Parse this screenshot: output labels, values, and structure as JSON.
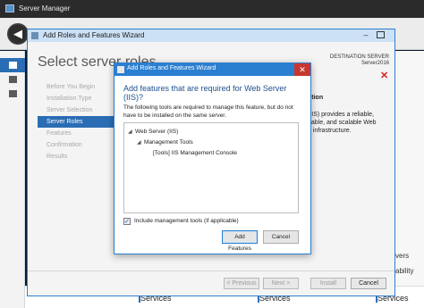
{
  "server_manager": {
    "title": "Server Manager",
    "back_glyph": "◀",
    "right_partial": [
      "vers",
      "ability"
    ],
    "tiles": [
      "Services",
      "Services",
      "Services"
    ]
  },
  "wizard": {
    "title": "Add Roles and Features Wizard",
    "heading": "Select server roles",
    "destination_label": "DESTINATION SERVER",
    "destination_value": "Server2016",
    "steps": [
      {
        "label": "Before You Begin",
        "active": false
      },
      {
        "label": "Installation Type",
        "active": false
      },
      {
        "label": "Server Selection",
        "active": false
      },
      {
        "label": "Server Roles",
        "active": true
      },
      {
        "label": "Features",
        "active": false
      },
      {
        "label": "Confirmation",
        "active": false
      },
      {
        "label": "Results",
        "active": false
      }
    ],
    "description_partial": {
      "header": "ption",
      "lines": [
        "(IIS) provides a reliable,",
        "eable, and scalable Web",
        "n infrastructure."
      ]
    },
    "buttons": {
      "previous": "< Previous",
      "next": "Next >",
      "install": "Install",
      "cancel": "Cancel"
    }
  },
  "dialog": {
    "title": "Add Roles and Features Wizard",
    "heading": "Add features that are required for Web Server (IIS)?",
    "description": "The following tools are required to manage this feature, but do not have to be installed on the same server.",
    "tree": [
      {
        "label": "Web Server (IIS)",
        "level": 0,
        "expanded": true
      },
      {
        "label": "Management Tools",
        "level": 1,
        "expanded": true
      },
      {
        "label": "[Tools] IIS Management Console",
        "level": 2,
        "expanded": false
      }
    ],
    "include_tools_checked": true,
    "include_tools_label": "Include management tools (if applicable)",
    "buttons": {
      "add": "Add Features",
      "cancel": "Cancel"
    },
    "close_glyph": "✕"
  },
  "colors": {
    "accent": "#2b7fd0",
    "selected_step": "#2b6db4",
    "close_red": "#c7372f",
    "heading_blue": "#1e4f8e"
  }
}
